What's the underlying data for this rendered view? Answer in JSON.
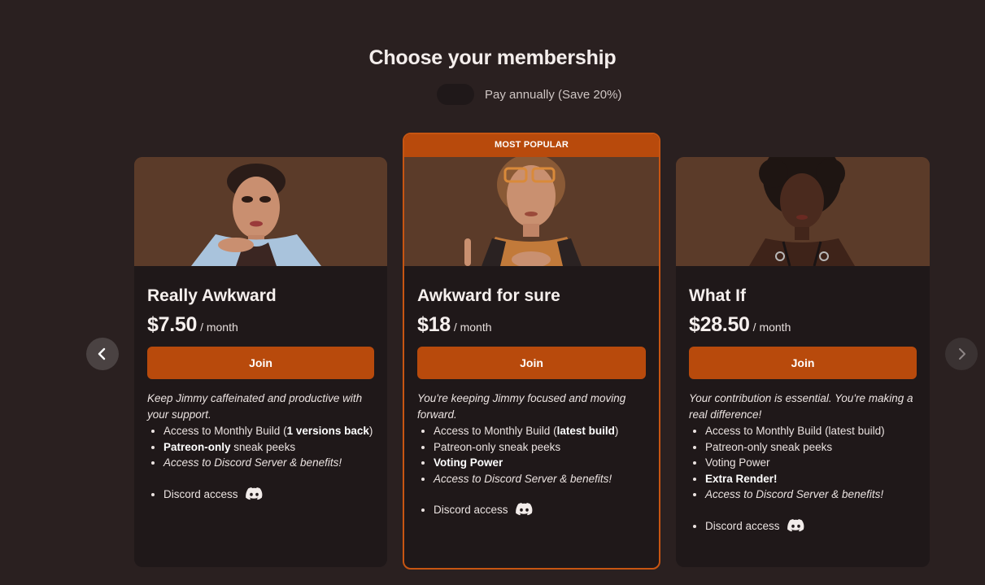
{
  "header": {
    "title": "Choose your membership",
    "toggle_label": "Pay annually (Save 20%)",
    "toggle_on": false
  },
  "icons": {
    "prev": "chevron-left-icon",
    "next": "chevron-right-icon",
    "discord": "discord-icon"
  },
  "colors": {
    "background": "#2a2020",
    "card": "#1f1819",
    "accent": "#b84a0c",
    "accent_border": "#c75512"
  },
  "tiers": [
    {
      "name": "Really Awkward",
      "price": "$7.50",
      "period": "/ month",
      "join_label": "Join",
      "tagline": "Keep Jimmy caffeinated and productive with your support.",
      "benefits": [
        {
          "pre": "Access to Monthly Build (",
          "bold": "1 versions back",
          "post": ")"
        },
        {
          "bold": "Patreon-only",
          "post": " sneak peeks"
        },
        {
          "italic": "Access to Discord Server & benefits!"
        }
      ],
      "discord_label": "Discord access"
    },
    {
      "badge": "MOST POPULAR",
      "name": "Awkward for sure",
      "price": "$18",
      "period": "/ month",
      "join_label": "Join",
      "tagline": "You're keeping Jimmy focused and moving forward.",
      "benefits": [
        {
          "pre": "Access to Monthly Build (",
          "bold": "latest build",
          "post": ")"
        },
        {
          "pre": "Patreon-only sneak peeks"
        },
        {
          "bold": "Voting Power"
        },
        {
          "italic": "Access to Discord Server & benefits!"
        }
      ],
      "discord_label": "Discord access"
    },
    {
      "name": "What If",
      "price": "$28.50",
      "period": "/ month",
      "join_label": "Join",
      "tagline": "Your contribution is essential. You're making a real difference!",
      "benefits": [
        {
          "pre": "Access to Monthly Build (latest build)"
        },
        {
          "pre": "Patreon-only sneak peeks"
        },
        {
          "pre": "Voting Power"
        },
        {
          "bold": "Extra Render!"
        },
        {
          "italic": "Access to Discord Server & benefits!"
        }
      ],
      "discord_label": "Discord access"
    }
  ]
}
